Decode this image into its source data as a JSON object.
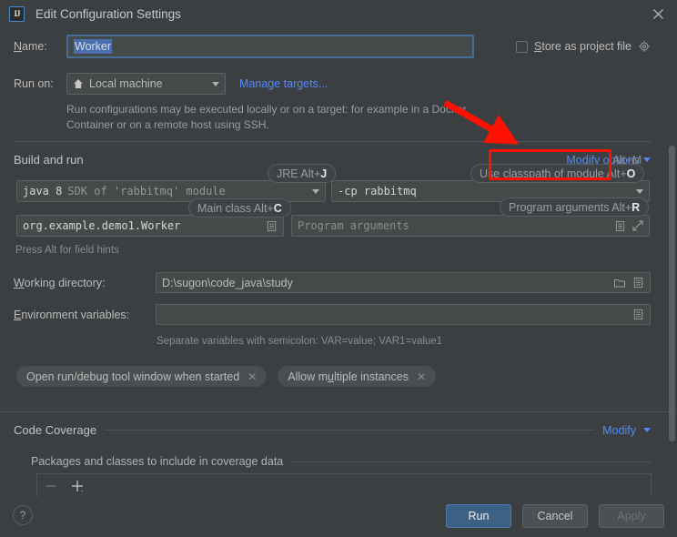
{
  "window": {
    "title": "Edit Configuration Settings",
    "logo_text": "IJ",
    "close_icon": "close-icon"
  },
  "name_row": {
    "label": "Name:",
    "value": "Worker",
    "store_checkbox_label": "Store as project file",
    "store_checked": false,
    "gear_icon": "gear-icon"
  },
  "run_on_row": {
    "label": "Run on:",
    "target_value": "Local machine",
    "target_icon": "home-icon",
    "manage_targets_link": "Manage targets..."
  },
  "description": "Run configurations may be executed locally or on a target: for example in a Docker Container or on a remote host using SSH.",
  "build_and_run": {
    "section_label": "Build and run",
    "modify_options_link": "Modify options",
    "modify_options_shortcut": "Alt+M",
    "jdk_value_bold": "java 8",
    "jdk_value_rest": "SDK of 'rabbitmq' module",
    "classpath_value": "-cp rabbitmq",
    "main_class_value": "org.example.demo1.Worker",
    "program_args_placeholder": "Program arguments",
    "alt_hint": "Press Alt for field hints",
    "hints": [
      {
        "name": "jre-hint",
        "text": "JRE Alt+",
        "key": "J"
      },
      {
        "name": "use-classpath-hint",
        "text": "Use classpath of module Alt+",
        "key": "O"
      },
      {
        "name": "main-class-hint",
        "text": "Main class Alt+",
        "key": "C"
      },
      {
        "name": "program-arguments-hint",
        "text": "Program arguments Alt+",
        "key": "R"
      }
    ]
  },
  "working_directory": {
    "label": "Working directory:",
    "value": "D:\\sugon\\code_java\\study",
    "folder_icon": "folder-icon",
    "macro_icon": "list-icon"
  },
  "environment_variables": {
    "label": "Environment variables:",
    "value": "",
    "browse_icon": "list-icon",
    "help_text": "Separate variables with semicolon: VAR=value; VAR1=value1"
  },
  "chips": [
    {
      "label": "Open run/debug tool window when started",
      "close_icon": "close-icon"
    },
    {
      "label": "Allow multiple instances",
      "close_icon": "close-icon"
    }
  ],
  "code_coverage": {
    "section_label": "Code Coverage",
    "modify_link": "Modify",
    "packages_label": "Packages and classes to include in coverage data",
    "remove_icon": "minus-icon",
    "add_icon": "plus-icon"
  },
  "footer": {
    "help_icon": "question-mark-icon",
    "run_label": "Run",
    "cancel_label": "Cancel",
    "apply_label": "Apply",
    "apply_enabled": false
  },
  "annotations": {
    "highlight_color": "#fe1100",
    "arrow_name": "red-arrow-annotation",
    "rect_name": "red-rectangle-annotation"
  },
  "colors": {
    "background": "#3c3f41",
    "field_background": "#45494a",
    "link_blue": "#548af7",
    "primary_button": "#3d6185",
    "selection_blue": "#4b6eaf",
    "annotation_red": "#fe1100"
  }
}
